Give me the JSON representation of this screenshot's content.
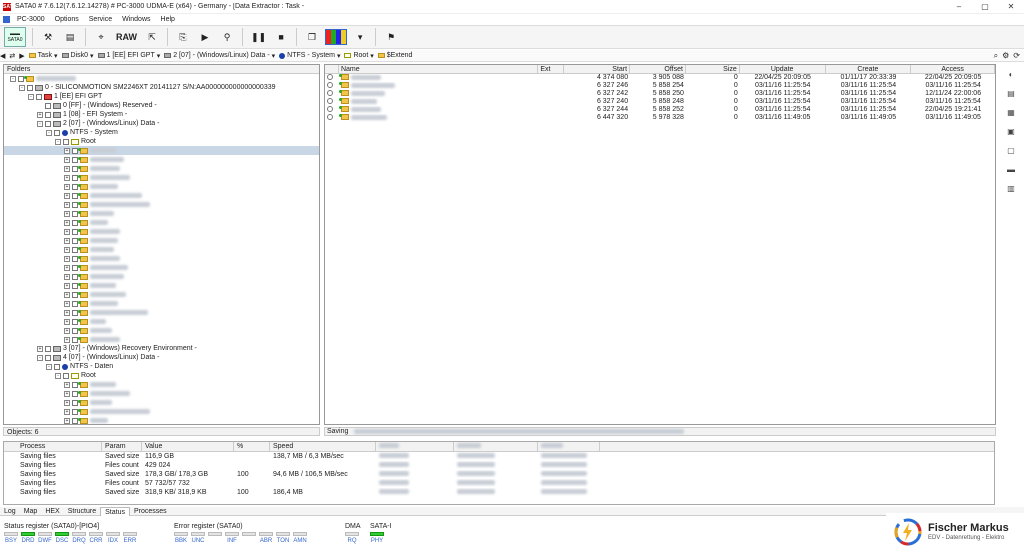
{
  "window": {
    "title": "SATA0 # 7.6.12(7.6.12.14278) # PC-3000 UDMA-E (x64) - Germany - [Data Extractor : Task - ",
    "app_icon": "SATA",
    "buttons": [
      "–",
      "▢",
      "✕"
    ]
  },
  "menu": {
    "items": [
      "PC-3000",
      "Options",
      "Service",
      "Windows",
      "Help"
    ]
  },
  "toolbar": {
    "sata_label": "SATA0",
    "raw_label": "RAW",
    "colors": {
      "active": "#3366cc"
    }
  },
  "path": {
    "items": [
      "Task",
      "Disk0",
      "1 [EE] EFI GPT",
      "2 [07] - (Windows/Linux) Data -",
      "NTFS - System",
      "Root",
      "$Extend"
    ]
  },
  "folders": {
    "header": "Folders",
    "tree": [
      {
        "indent": 0,
        "exp": "-",
        "icon": "fold",
        "text": "",
        "blur": 40
      },
      {
        "indent": 1,
        "exp": "-",
        "icon": "disk",
        "text": "0 - SILICONMOTION SM2246XT 20141127 S/N:AA000000000000000339"
      },
      {
        "indent": 2,
        "exp": "-",
        "icon": "part",
        "text": "1 [EE] EFI GPT"
      },
      {
        "indent": 3,
        "exp": "",
        "icon": "disk",
        "text": "0 [FF] - (Windows) Reserved -"
      },
      {
        "indent": 3,
        "exp": "+",
        "icon": "disk",
        "text": "1 [08] - EFI System -"
      },
      {
        "indent": 3,
        "exp": "-",
        "icon": "disk",
        "text": "2 [07] - (Windows/Linux) Data -"
      },
      {
        "indent": 4,
        "exp": "-",
        "icon": "ntfs",
        "text": "NTFS - System"
      },
      {
        "indent": 5,
        "exp": "-",
        "icon": "root",
        "text": "Root"
      },
      {
        "indent": 6,
        "exp": "+",
        "icon": "fold",
        "text": "",
        "blur": 26,
        "sel": true
      },
      {
        "indent": 6,
        "exp": "+",
        "icon": "fold",
        "text": "",
        "blur": 34
      },
      {
        "indent": 6,
        "exp": "+",
        "icon": "fold",
        "text": "",
        "blur": 30
      },
      {
        "indent": 6,
        "exp": "+",
        "icon": "fold",
        "text": "",
        "blur": 40
      },
      {
        "indent": 6,
        "exp": "+",
        "icon": "fold",
        "text": "",
        "blur": 28
      },
      {
        "indent": 6,
        "exp": "+",
        "icon": "fold",
        "text": "",
        "blur": 52
      },
      {
        "indent": 6,
        "exp": "+",
        "icon": "fold",
        "text": "",
        "blur": 60
      },
      {
        "indent": 6,
        "exp": "+",
        "icon": "fold",
        "text": "",
        "blur": 24
      },
      {
        "indent": 6,
        "exp": "+",
        "icon": "fold",
        "text": "",
        "blur": 18
      },
      {
        "indent": 6,
        "exp": "+",
        "icon": "fold",
        "text": "",
        "blur": 30
      },
      {
        "indent": 6,
        "exp": "+",
        "icon": "fold",
        "text": "",
        "blur": 28
      },
      {
        "indent": 6,
        "exp": "+",
        "icon": "fold",
        "text": "",
        "blur": 24
      },
      {
        "indent": 6,
        "exp": "+",
        "icon": "fold",
        "text": "",
        "blur": 30
      },
      {
        "indent": 6,
        "exp": "+",
        "icon": "fold",
        "text": "",
        "blur": 38
      },
      {
        "indent": 6,
        "exp": "+",
        "icon": "fold",
        "text": "",
        "blur": 34
      },
      {
        "indent": 6,
        "exp": "+",
        "icon": "fold",
        "text": "",
        "blur": 26
      },
      {
        "indent": 6,
        "exp": "+",
        "icon": "fold",
        "text": "",
        "blur": 36
      },
      {
        "indent": 6,
        "exp": "+",
        "icon": "fold",
        "text": "",
        "blur": 28
      },
      {
        "indent": 6,
        "exp": "+",
        "icon": "fold",
        "text": "",
        "blur": 58
      },
      {
        "indent": 6,
        "exp": "+",
        "icon": "fold",
        "text": "",
        "blur": 16
      },
      {
        "indent": 6,
        "exp": "+",
        "icon": "fold",
        "text": "",
        "blur": 22
      },
      {
        "indent": 6,
        "exp": "+",
        "icon": "fold",
        "text": "",
        "blur": 30
      },
      {
        "indent": 3,
        "exp": "+",
        "icon": "disk",
        "text": "3 [07] - (Windows) Recovery Environment -"
      },
      {
        "indent": 3,
        "exp": "-",
        "icon": "disk",
        "text": "4 [07] - (Windows/Linux) Data -"
      },
      {
        "indent": 4,
        "exp": "-",
        "icon": "ntfs",
        "text": "NTFS - Daten"
      },
      {
        "indent": 5,
        "exp": "-",
        "icon": "root",
        "text": "Root"
      },
      {
        "indent": 6,
        "exp": "+",
        "icon": "fold",
        "text": "",
        "blur": 26
      },
      {
        "indent": 6,
        "exp": "+",
        "icon": "fold",
        "text": "",
        "blur": 40
      },
      {
        "indent": 6,
        "exp": "+",
        "icon": "fold",
        "text": "",
        "blur": 22
      },
      {
        "indent": 6,
        "exp": "+",
        "icon": "fold",
        "text": "",
        "blur": 60
      },
      {
        "indent": 6,
        "exp": "+",
        "icon": "fold",
        "text": "",
        "blur": 18
      },
      {
        "indent": 6,
        "exp": "+",
        "icon": "fold",
        "text": "",
        "blur": 120
      }
    ],
    "objects_label": "Objects: 6"
  },
  "files": {
    "columns": [
      "Name",
      "Ext",
      "Start",
      "Offset",
      "Size",
      "Update",
      "Create",
      "Access"
    ],
    "rows": [
      {
        "start": "4 374 080",
        "offset": "3 905 088",
        "size": "0",
        "update": "22/04/25 20:09:05",
        "create": "01/11/17 20:33:39",
        "access": "22/04/25 20:09:05",
        "blur": 30
      },
      {
        "start": "6 327 246",
        "offset": "5 858 254",
        "size": "0",
        "update": "03/11/16 11:25:54",
        "create": "03/11/16 11:25:54",
        "access": "03/11/16 11:25:54",
        "blur": 44
      },
      {
        "start": "6 327 242",
        "offset": "5 858 250",
        "size": "0",
        "update": "03/11/16 11:25:54",
        "create": "03/11/16 11:25:54",
        "access": "12/11/24 22:00:06",
        "blur": 34
      },
      {
        "start": "6 327 240",
        "offset": "5 858 248",
        "size": "0",
        "update": "03/11/16 11:25:54",
        "create": "03/11/16 11:25:54",
        "access": "03/11/16 11:25:54",
        "blur": 26
      },
      {
        "start": "6 327 244",
        "offset": "5 858 252",
        "size": "0",
        "update": "03/11/16 11:25:54",
        "create": "03/11/16 11:25:54",
        "access": "22/04/25 19:21:41",
        "blur": 30
      },
      {
        "start": "6 447 320",
        "offset": "5 978 328",
        "size": "0",
        "update": "03/11/16 11:49:05",
        "create": "03/11/16 11:49:05",
        "access": "03/11/16 11:49:05",
        "blur": 36
      }
    ],
    "saving_label": "Saving"
  },
  "status": {
    "columns": [
      "Process",
      "Param",
      "Value",
      "%",
      "Speed"
    ],
    "rows": [
      {
        "process": "Saving files",
        "param": "Saved size",
        "value": "116,9 GB",
        "pct": "",
        "speed": "138,7 MB / 6,3 MB/sec"
      },
      {
        "process": "Saving files",
        "param": "Files count",
        "value": "429 024",
        "pct": "",
        "speed": ""
      },
      {
        "process": "Saving files",
        "param": "Saved size",
        "value": "178,3 GB/ 178,3 GB",
        "pct": "100",
        "speed": "94,6 MB / 106,5 MB/sec"
      },
      {
        "process": "Saving files",
        "param": "Files count",
        "value": "57 732/57 732",
        "pct": "",
        "speed": ""
      },
      {
        "process": "Saving files",
        "param": "Saved size",
        "value": "318,9 KB/ 318,9 KB",
        "pct": "100",
        "speed": "186,4 MB"
      }
    ]
  },
  "tabs": {
    "items": [
      "Log",
      "Map",
      "HEX",
      "Structure",
      "Status",
      "Processes"
    ],
    "active_index": 4
  },
  "registers": {
    "status_label": "Status register (SATA0)-[PIO4]",
    "status_bits": [
      {
        "name": "BSY",
        "on": false
      },
      {
        "name": "DRD",
        "on": true
      },
      {
        "name": "DWF",
        "on": false
      },
      {
        "name": "DSC",
        "on": true
      },
      {
        "name": "DRQ",
        "on": false
      },
      {
        "name": "CRR",
        "on": false
      },
      {
        "name": "IDX",
        "on": false
      },
      {
        "name": "ERR",
        "on": false
      }
    ],
    "error_label": "Error register (SATA0)",
    "error_bits": [
      {
        "name": "BBK",
        "on": false
      },
      {
        "name": "UNC",
        "on": false
      },
      {
        "name": "",
        "on": false
      },
      {
        "name": "INF",
        "on": false
      },
      {
        "name": "",
        "on": false
      },
      {
        "name": "ABR",
        "on": false
      },
      {
        "name": "TON",
        "on": false
      },
      {
        "name": "AMN",
        "on": false
      }
    ],
    "dma_label": "DMA",
    "dma_bits": [
      {
        "name": "RQ",
        "on": false
      }
    ],
    "sata_label": "SATA-I",
    "sata_bits": [
      {
        "name": "PHY",
        "on": true
      }
    ]
  },
  "logo": {
    "name": "Fischer Markus",
    "sub": "EDV - Datenrettung - Elektro"
  }
}
